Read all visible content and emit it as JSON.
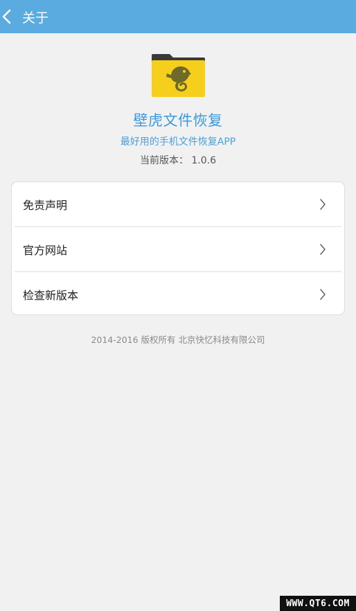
{
  "header": {
    "back_icon": "chevron-left-icon",
    "title": "关于"
  },
  "app": {
    "icon": "folder-chameleon-icon",
    "name": "壁虎文件恢复",
    "slogan": "最好用的手机文件恢复APP",
    "version": "当前版本： 1.0.6"
  },
  "menu": {
    "items": [
      {
        "label": "免责声明",
        "icon": "chevron-right-icon"
      },
      {
        "label": "官方网站",
        "icon": "chevron-right-icon"
      },
      {
        "label": "检查新版本",
        "icon": "chevron-right-icon"
      }
    ]
  },
  "footer": {
    "copyright": "2014-2016 版权所有 北京快忆科技有限公司"
  },
  "watermark": {
    "text": "WWW.QT6.COM"
  },
  "colors": {
    "header_bg": "#5aabe0",
    "accent_blue": "#3d98d8",
    "page_bg": "#f1f1f1",
    "folder_yellow": "#f5cf1c",
    "folder_dark": "#3a3a3a",
    "chameleon": "#6e6a2c"
  }
}
